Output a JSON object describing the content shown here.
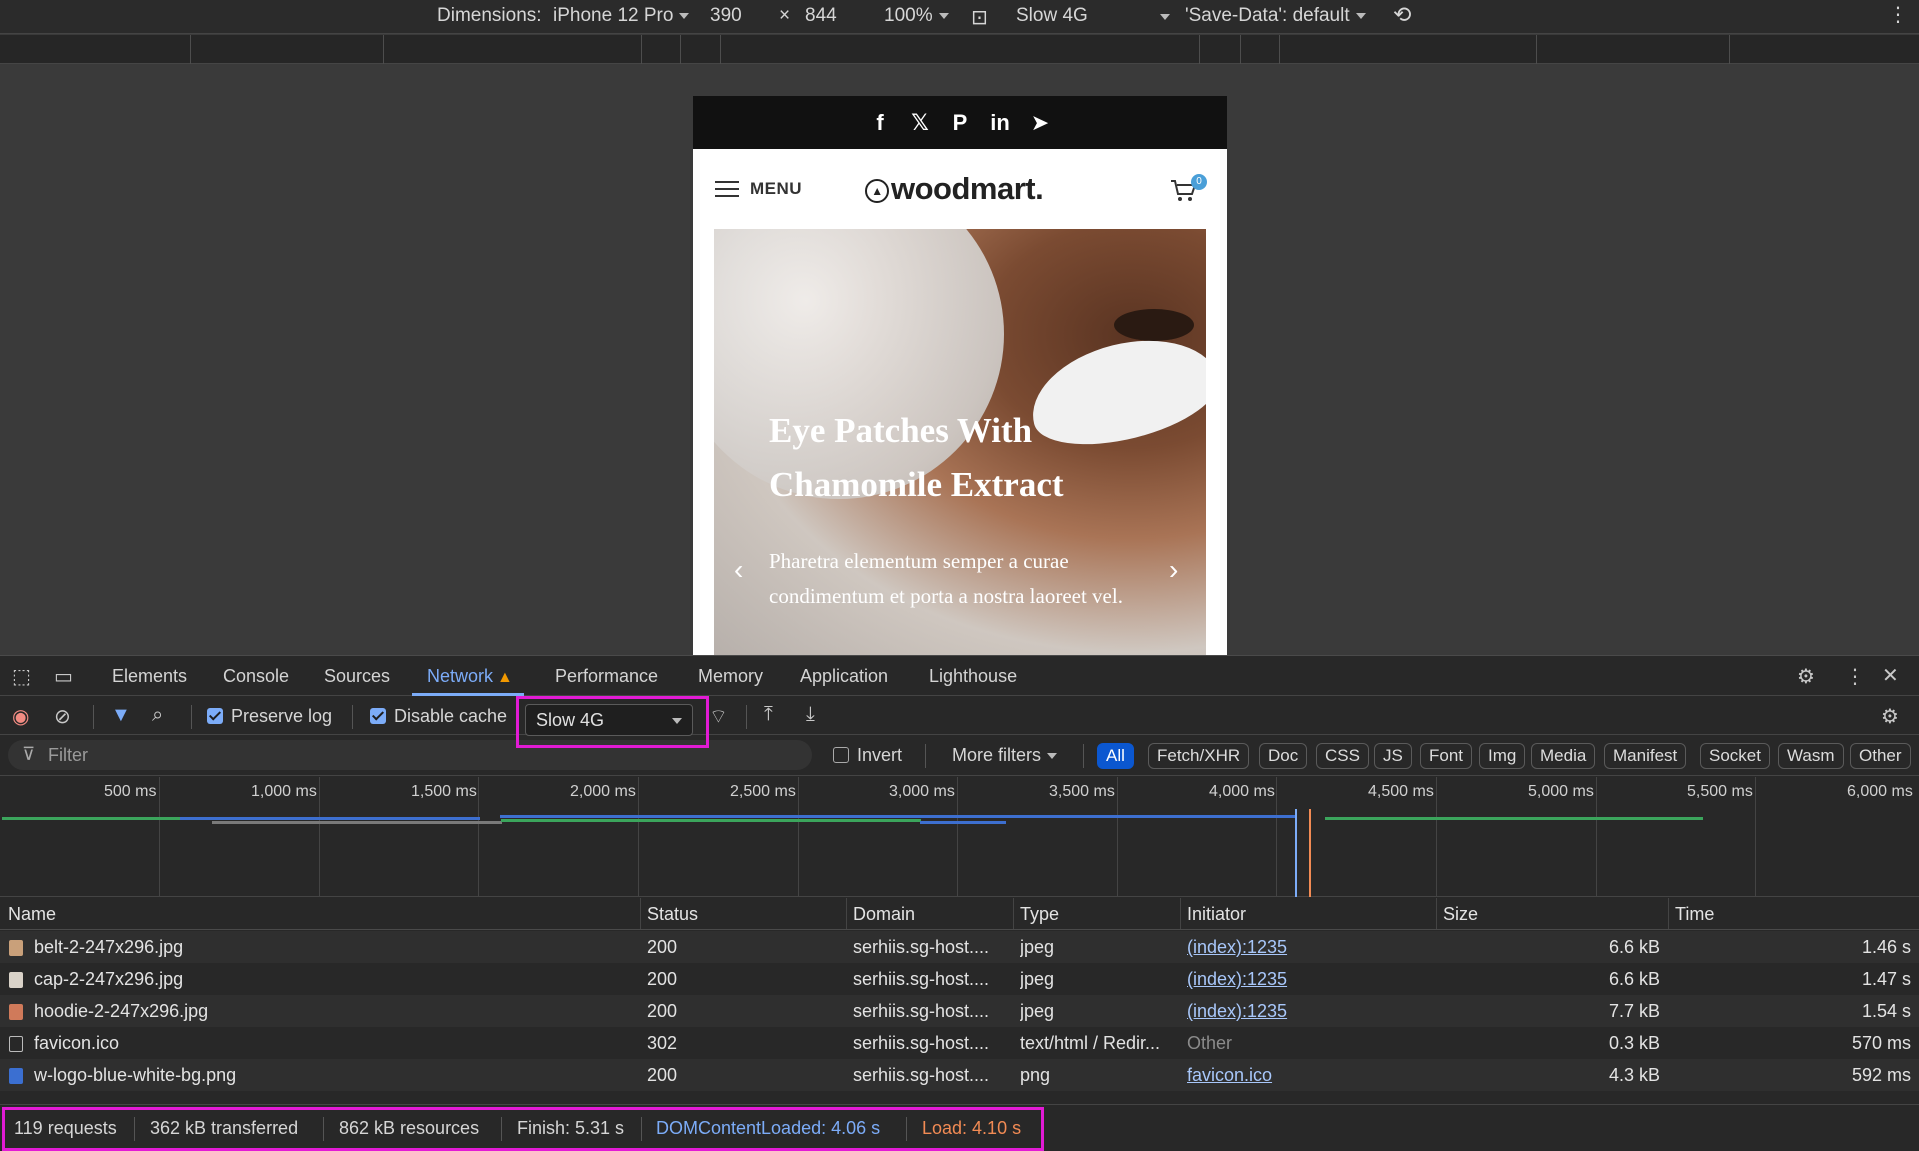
{
  "device_toolbar": {
    "dimensions_label": "Dimensions:",
    "device": "iPhone 12 Pro",
    "width": "390",
    "times": "×",
    "height": "844",
    "zoom": "100%",
    "throttle": "Slow 4G",
    "save_data": "'Save-Data': default"
  },
  "site": {
    "menu_label": "MENU",
    "logo_text": "woodmart.",
    "cart_count": "0",
    "social": [
      "f",
      "𝕏",
      "P",
      "in",
      "➤"
    ],
    "hero_title": "Eye Patches With Chamomile Extract",
    "hero_subtitle": "Pharetra elementum semper a curae condimentum et porta a nostra laoreet vel.",
    "prev_arrow": "‹",
    "next_arrow": "›"
  },
  "devtools": {
    "tabs": [
      "Elements",
      "Console",
      "Sources",
      "Network",
      "Performance",
      "Memory",
      "Application",
      "Lighthouse"
    ],
    "active_tab": "Network",
    "toolbar": {
      "preserve_log": "Preserve log",
      "disable_cache": "Disable cache",
      "throttle": "Slow 4G"
    },
    "filter": {
      "placeholder": "Filter",
      "invert": "Invert",
      "more_filters": "More filters",
      "chips": [
        "All",
        "Fetch/XHR",
        "Doc",
        "CSS",
        "JS",
        "Font",
        "Img",
        "Media",
        "Manifest",
        "Socket",
        "Wasm",
        "Other"
      ],
      "active_chip": "All"
    },
    "timeline_ticks": [
      "500 ms",
      "1,000 ms",
      "1,500 ms",
      "2,000 ms",
      "2,500 ms",
      "3,000 ms",
      "3,500 ms",
      "4,000 ms",
      "4,500 ms",
      "5,000 ms",
      "5,500 ms",
      "6,000 ms"
    ],
    "columns": [
      "Name",
      "Status",
      "Domain",
      "Type",
      "Initiator",
      "Size",
      "Time"
    ],
    "rows": [
      {
        "name": "belt-2-247x296.jpg",
        "status": "200",
        "domain": "serhiis.sg-host....",
        "type": "jpeg",
        "initiator": "(index):1235",
        "initiator_link": true,
        "size": "6.6 kB",
        "time": "1.46 s",
        "icon_color": "#c9a07a"
      },
      {
        "name": "cap-2-247x296.jpg",
        "status": "200",
        "domain": "serhiis.sg-host....",
        "type": "jpeg",
        "initiator": "(index):1235",
        "initiator_link": true,
        "size": "6.6 kB",
        "time": "1.47 s",
        "icon_color": "#d9d2c8"
      },
      {
        "name": "hoodie-2-247x296.jpg",
        "status": "200",
        "domain": "serhiis.sg-host....",
        "type": "jpeg",
        "initiator": "(index):1235",
        "initiator_link": true,
        "size": "7.7 kB",
        "time": "1.54 s",
        "icon_color": "#d07a5a"
      },
      {
        "name": "favicon.ico",
        "status": "302",
        "domain": "serhiis.sg-host....",
        "type": "text/html / Redir...",
        "initiator": "Other",
        "initiator_link": false,
        "size": "0.3 kB",
        "time": "570 ms",
        "icon_color": "none"
      },
      {
        "name": "w-logo-blue-white-bg.png",
        "status": "200",
        "domain": "serhiis.sg-host....",
        "type": "png",
        "initiator": "favicon.ico",
        "initiator_link": true,
        "size": "4.3 kB",
        "time": "592 ms",
        "icon_color": "#3b6fd1"
      }
    ],
    "status": {
      "requests": "119 requests",
      "transferred": "362 kB transferred",
      "resources": "862 kB resources",
      "finish": "Finish: 5.31 s",
      "dom_content_loaded": "DOMContentLoaded: 4.06 s",
      "load": "Load: 4.10 s"
    }
  },
  "colors": {
    "accent": "#7cacf8",
    "highlight_box": "#e21bd5",
    "warning": "#f29900",
    "load_orange": "#f28b54"
  }
}
